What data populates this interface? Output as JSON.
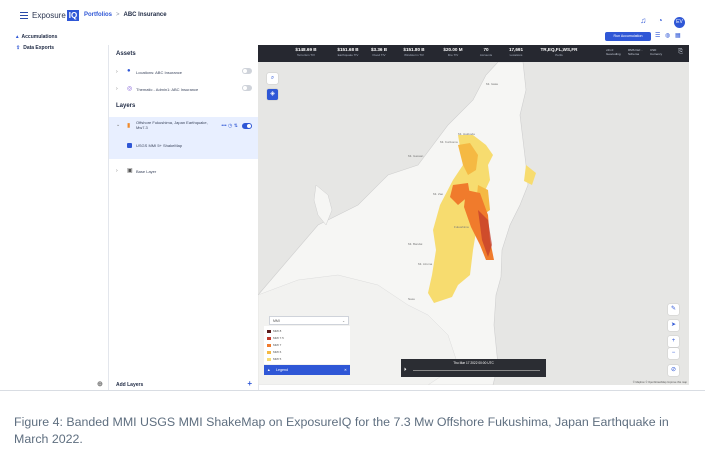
{
  "header": {
    "logo_text": "Exposure",
    "logo_badge": "IQ",
    "breadcrumb_portfolios": "Portfolios",
    "breadcrumb_separator": ">",
    "breadcrumb_current": "ABC Insurance",
    "avatar_initials": "EV",
    "icons": [
      "bell-icon",
      "notifications-icon",
      "help-icon"
    ]
  },
  "nav": {
    "items": [
      {
        "label": "Accumulations",
        "icon": "warning-icon"
      },
      {
        "label": "Data Exports",
        "icon": "export-icon"
      }
    ]
  },
  "panel": {
    "assets_title": "Assets",
    "assets": [
      {
        "label": "Locations: ABC Insurance"
      },
      {
        "label": "Thematic - Admin1: ABC Insurance"
      }
    ],
    "layers_title": "Layers",
    "event_layer": "Offshore Fukushima, Japan Earthquake, Mw7.3",
    "event_sublayer": "USGS MMI 5+ ShakeMap",
    "base_layer": "Base Layer",
    "add_layers": "Add Layers"
  },
  "summary": {
    "run_button": "Run Accumulation",
    "stats": [
      {
        "value": "$148.69 B",
        "label": "Terrorism TIV"
      },
      {
        "value": "$151.68 B",
        "label": "Earthquake TIV"
      },
      {
        "value": "$3.36 B",
        "label": "Flood TIV"
      },
      {
        "value": "$151.80 B",
        "label": "Windstorm TIV"
      },
      {
        "value": "$20.00 M",
        "label": "Fire TIV"
      },
      {
        "value": "70",
        "label": "Accounts"
      },
      {
        "value": "17,691",
        "label": "Locations"
      },
      {
        "value": "TR,EQ,FL,WS,FR",
        "label": "Perils"
      }
    ],
    "right_meta": [
      {
        "value": "v21.0",
        "label": "Geocoding"
      },
      {
        "value": "RMS Def...",
        "label": "Schema"
      },
      {
        "value": "USD",
        "label": "Currency"
      }
    ]
  },
  "map": {
    "labels": [
      "Mt. Iwate",
      "Mt. Hakkoda",
      "Mt. Gassan",
      "Mt. Kurikoma",
      "Mt. Zao",
      "Fukushima",
      "Mt. Bandai",
      "Mt. Azuma",
      "Nasu"
    ],
    "search_icon": "search-icon",
    "layers_icon": "layers-icon",
    "mmi_select_label": "MMI",
    "legend_items": [
      {
        "label": "MMI 8",
        "color": "#5a1a1a"
      },
      {
        "label": "MMI 7.5",
        "color": "#c0392b"
      },
      {
        "label": "MMI 7",
        "color": "#f07b2c"
      },
      {
        "label": "MMI 6",
        "color": "#f5b943"
      },
      {
        "label": "MMI 5",
        "color": "#f7dc6f"
      }
    ],
    "legend_button": "Legend",
    "time_label": "Thu Mar 17 2022 00:00 UTC",
    "attribution": "© Mapbox © OpenStreetMap  Improve this map"
  },
  "caption": "Figure 4: Banded MMI USGS MMI ShakeMap on ExposureIQ for the 7.3 Mw Offshore Fukushima, Japan Earthquake in March 2022."
}
